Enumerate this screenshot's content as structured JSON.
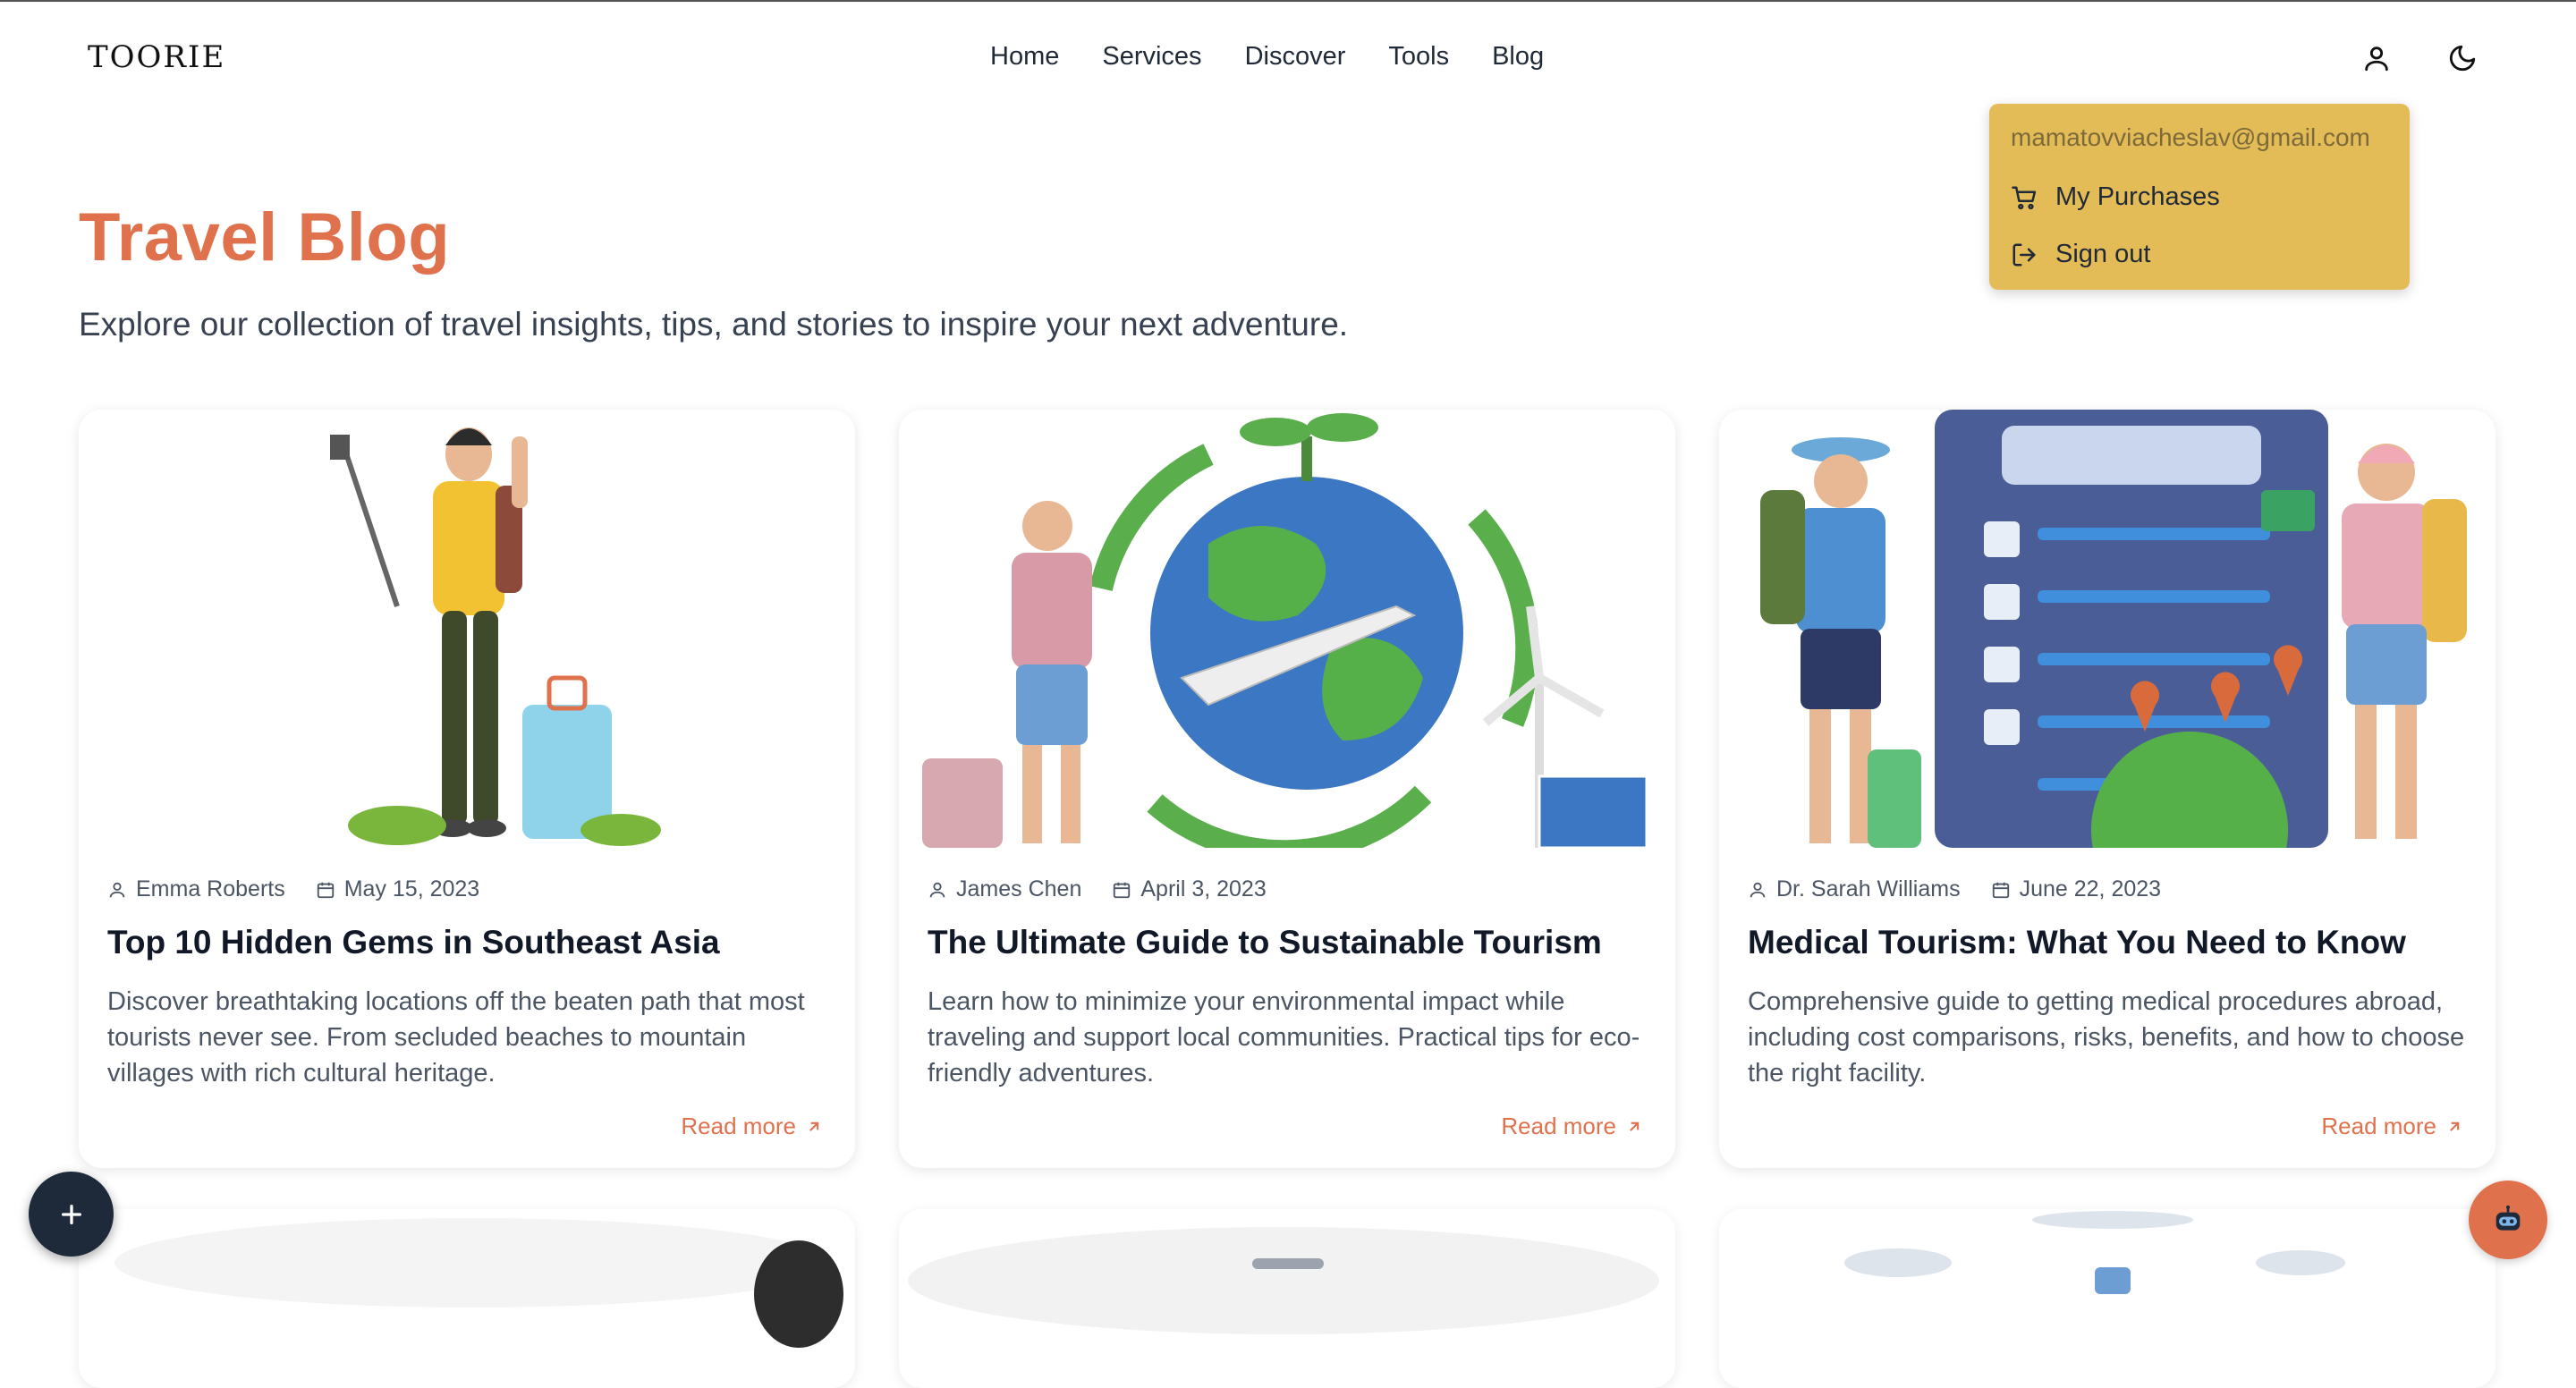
{
  "header": {
    "logo": "TOORIE",
    "nav": [
      "Home",
      "Services",
      "Discover",
      "Tools",
      "Blog"
    ],
    "user_icon": "user-icon",
    "theme_icon": "moon-icon"
  },
  "account_menu": {
    "email": "mamatovviacheslav@gmail.com",
    "purchases": "My Purchases",
    "sign_out": "Sign out",
    "bg_color": "#e3bc57"
  },
  "page": {
    "title": "Travel Blog",
    "subtitle": "Explore our collection of travel insights, tips, and stories to inspire your next adventure.",
    "accent_color": "#e0714d"
  },
  "posts": [
    {
      "author": "Emma Roberts",
      "date": "May 15, 2023",
      "title": "Top 10 Hidden Gems in Southeast Asia",
      "description": "Discover breathtaking locations off the beaten path that most tourists never see. From secluded beaches to mountain villages with rich cultural heritage.",
      "read_more": "Read more"
    },
    {
      "author": "James Chen",
      "date": "April 3, 2023",
      "title": "The Ultimate Guide to Sustainable Tourism",
      "description": "Learn how to minimize your environmental impact while traveling and support local communities. Practical tips for eco-friendly adventures.",
      "read_more": "Read more"
    },
    {
      "author": "Dr. Sarah Williams",
      "date": "June 22, 2023",
      "title": "Medical Tourism: What You Need to Know",
      "description": "Comprehensive guide to getting medical procedures abroad, including cost comparisons, risks, benefits, and how to choose the right facility.",
      "read_more": "Read more"
    }
  ],
  "floating": {
    "fab_icon": "plus-icon",
    "chat_icon": "robot-icon"
  }
}
